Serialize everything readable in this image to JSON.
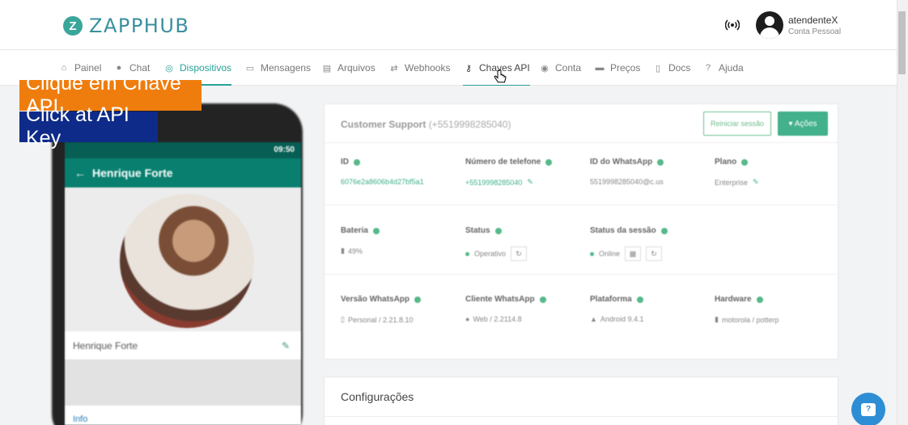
{
  "brand": {
    "logo_text": "ZAPPHUB",
    "logo_mark": "Z",
    "accent": "#2aa198"
  },
  "user": {
    "name": "atendenteX",
    "subtitle": "Conta Pessoal"
  },
  "nav": {
    "items": [
      {
        "label": "Painel",
        "icon": "home-icon"
      },
      {
        "label": "Chat",
        "icon": "chat-icon"
      },
      {
        "label": "Dispositivos",
        "icon": "whatsapp-icon",
        "active": true
      },
      {
        "label": "Mensagens",
        "icon": "messages-icon"
      },
      {
        "label": "Arquivos",
        "icon": "file-icon"
      },
      {
        "label": "Webhooks",
        "icon": "exchange-icon"
      },
      {
        "label": "Chaves API",
        "icon": "key-icon"
      },
      {
        "label": "Conta",
        "icon": "user-icon"
      },
      {
        "label": "Preços",
        "icon": "price-icon"
      },
      {
        "label": "Docs",
        "icon": "doc-icon"
      },
      {
        "label": "Ajuda",
        "icon": "help-icon"
      }
    ]
  },
  "captions": {
    "pt": "Clique em Chave API",
    "en": "Click at API Key"
  },
  "phone": {
    "time": "09:50",
    "contact_name": "Henrique Forte",
    "profile_name": "Henrique Forte",
    "info_label": "Info"
  },
  "device_card": {
    "title": "Customer Support",
    "number": "(+5519998285040)",
    "reset_label": "Reiniciar sessão",
    "actions_label": "▾ Ações",
    "fields": {
      "id": {
        "label": "ID",
        "value": "6076e2a8606b4d27bf5a1"
      },
      "phone": {
        "label": "Número de telefone",
        "value": "+5519998285040"
      },
      "wid": {
        "label": "ID do WhatsApp",
        "value": "5519998285040@c.us"
      },
      "plan": {
        "label": "Plano",
        "value": "Enterprise"
      },
      "battery": {
        "label": "Bateria",
        "value": "49%"
      },
      "status": {
        "label": "Status",
        "value": "Operativo"
      },
      "session": {
        "label": "Status da sessão",
        "value": "Online"
      },
      "wa_version": {
        "label": "Versão WhatsApp",
        "value": "Personal / 2.21.8.10"
      },
      "client": {
        "label": "Cliente WhatsApp",
        "value": "Web / 2.2114.8"
      },
      "platform": {
        "label": "Plataforma",
        "value": "Android 9.4.1"
      },
      "hardware": {
        "label": "Hardware",
        "value": "motorola / potterp"
      }
    }
  },
  "config_card": {
    "title": "Configurações"
  }
}
